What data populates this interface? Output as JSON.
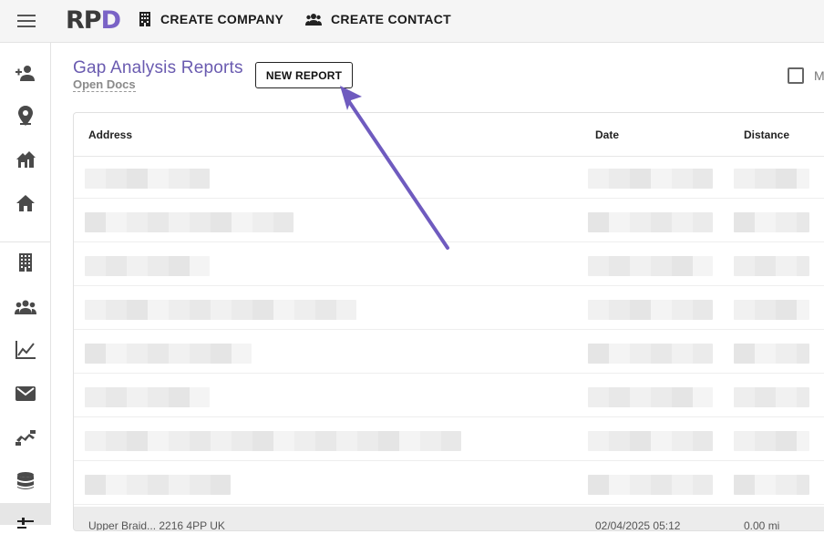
{
  "app": {
    "logo_main": "RP",
    "logo_accent": "D"
  },
  "topnav": {
    "create_company": "CREATE COMPANY",
    "create_contact": "CREATE CONTACT"
  },
  "sidebar": {
    "items": [
      {
        "icon": "add-person-icon"
      },
      {
        "icon": "map-pin-icon"
      },
      {
        "icon": "multi-home-icon"
      },
      {
        "icon": "home-icon"
      },
      {
        "icon": "building-icon"
      },
      {
        "icon": "people-icon"
      },
      {
        "icon": "line-chart-icon"
      },
      {
        "icon": "mail-icon"
      },
      {
        "icon": "handshake-icon"
      },
      {
        "icon": "database-icon"
      },
      {
        "icon": "sliders-icon"
      }
    ]
  },
  "header": {
    "title": "Gap Analysis Reports",
    "open_docs": "Open Docs",
    "new_report": "NEW REPORT",
    "checkbox_label": "M"
  },
  "table": {
    "columns": [
      "Address",
      "Date",
      "Distance"
    ],
    "footer_row": {
      "address": "Upper Braid... 2216 4PP UK",
      "date": "02/04/2025 05:12",
      "distance": "0.00 mi"
    }
  },
  "colors": {
    "accent": "#7a63c6",
    "title": "#6a5bb0",
    "arrow": "#6f5bbf"
  }
}
